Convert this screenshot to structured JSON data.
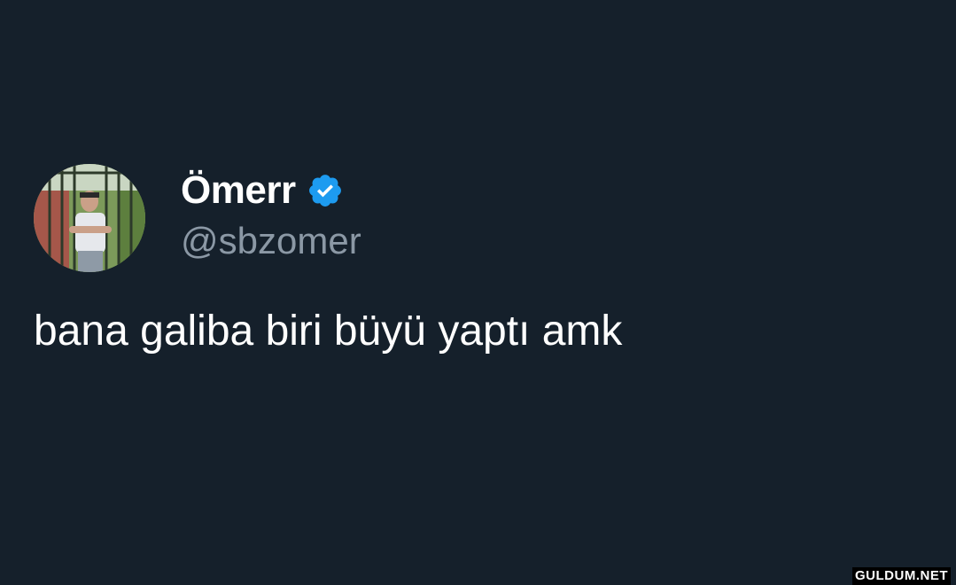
{
  "tweet": {
    "display_name": "Ömerr",
    "handle": "@sbzomer",
    "text": "bana galiba biri büyü yaptı amk",
    "verified": true
  },
  "watermark": "GULDUM.NET",
  "colors": {
    "background": "#15202b",
    "verified_badge": "#1d9bf0",
    "handle": "#8b98a5"
  },
  "icons": {
    "verified": "verified-badge-icon",
    "avatar": "profile-avatar"
  }
}
